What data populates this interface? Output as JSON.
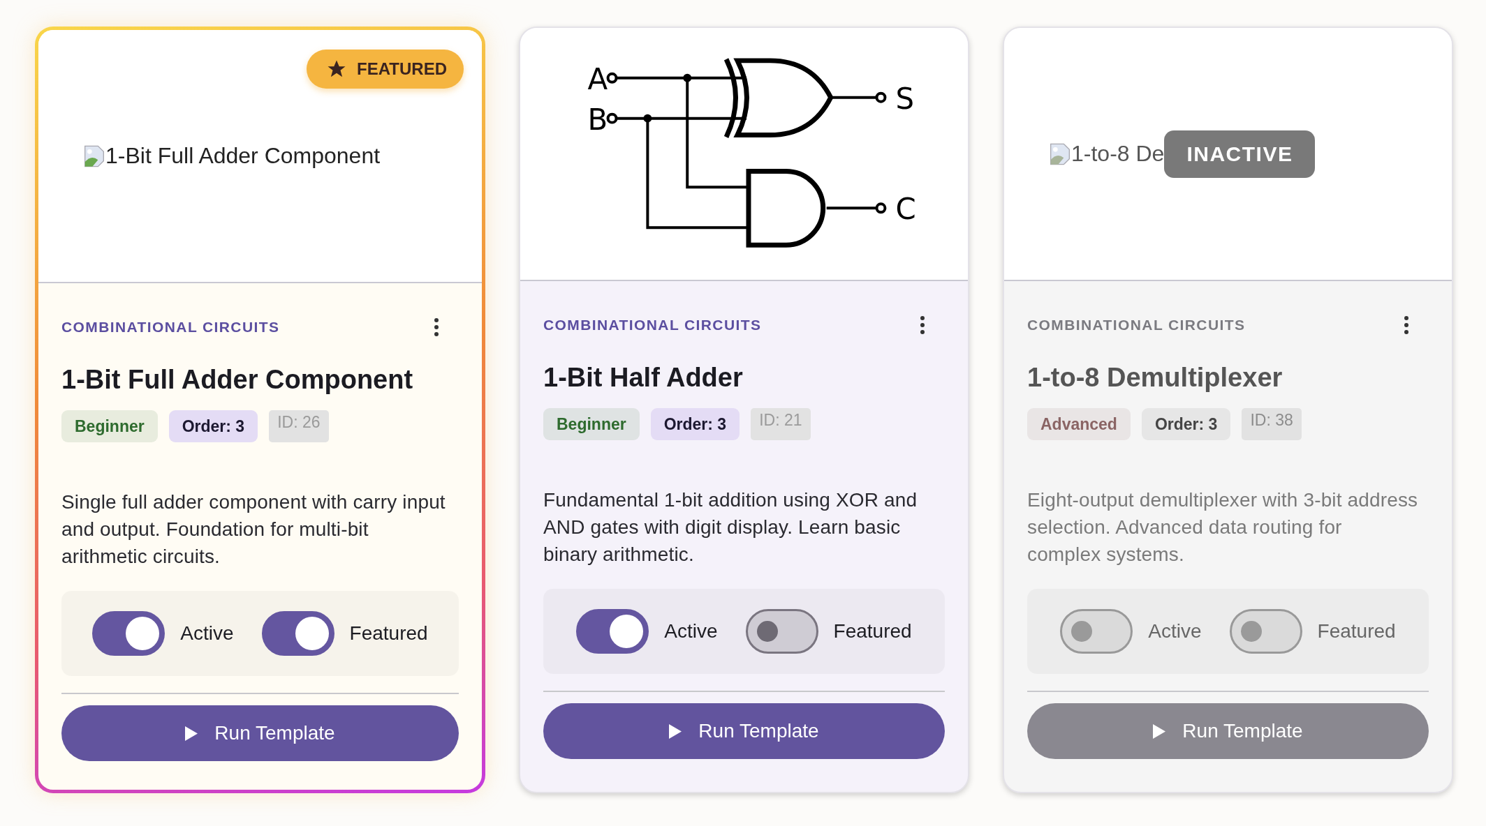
{
  "cards": [
    {
      "image": {
        "kind": "broken",
        "alt": "1-Bit Full Adder Component"
      },
      "badge": {
        "kind": "featured",
        "text": "FEATURED"
      },
      "category": "COMBINATIONAL CIRCUITS",
      "title": "1-Bit Full Adder Component",
      "chips": [
        {
          "kind": "level",
          "text": "Beginner",
          "color": "#2e6b2e"
        },
        {
          "kind": "order",
          "text": "Order: 3"
        },
        {
          "kind": "id",
          "text": "ID: 26"
        }
      ],
      "description": "Single full adder component with carry input and output. Foundation for multi-bit arithmetic circuits.",
      "toggles": [
        {
          "label": "Active",
          "on": true
        },
        {
          "label": "Featured",
          "on": true
        }
      ],
      "button": "Run Template"
    },
    {
      "image": {
        "kind": "diagram",
        "labels": [
          "A",
          "B",
          "S",
          "C"
        ]
      },
      "category": "COMBINATIONAL CIRCUITS",
      "title": "1-Bit Half Adder",
      "chips": [
        {
          "kind": "level",
          "text": "Beginner",
          "color": "#2e6b2e"
        },
        {
          "kind": "order",
          "text": "Order: 3"
        },
        {
          "kind": "id",
          "text": "ID: 21"
        }
      ],
      "description": "Fundamental 1-bit addition using XOR and AND gates with digit display. Learn basic binary arithmetic.",
      "toggles": [
        {
          "label": "Active",
          "on": true
        },
        {
          "label": "Featured",
          "on": false
        }
      ],
      "button": "Run Template"
    },
    {
      "image": {
        "kind": "broken",
        "alt": "1-to-8 De"
      },
      "badge": {
        "kind": "inactive",
        "text": "INACTIVE"
      },
      "category": "COMBINATIONAL CIRCUITS",
      "title": "1-to-8 Demultiplexer",
      "chips": [
        {
          "kind": "level",
          "text": "Advanced",
          "color": "#8a6464"
        },
        {
          "kind": "order",
          "text": "Order: 3"
        },
        {
          "kind": "id",
          "text": "ID: 38"
        }
      ],
      "description": "Eight-output demultiplexer with 3-bit address selection. Advanced data routing for complex systems.",
      "toggles": [
        {
          "label": "Active",
          "on": false
        },
        {
          "label": "Featured",
          "on": false
        }
      ],
      "button": "Run Template"
    }
  ]
}
